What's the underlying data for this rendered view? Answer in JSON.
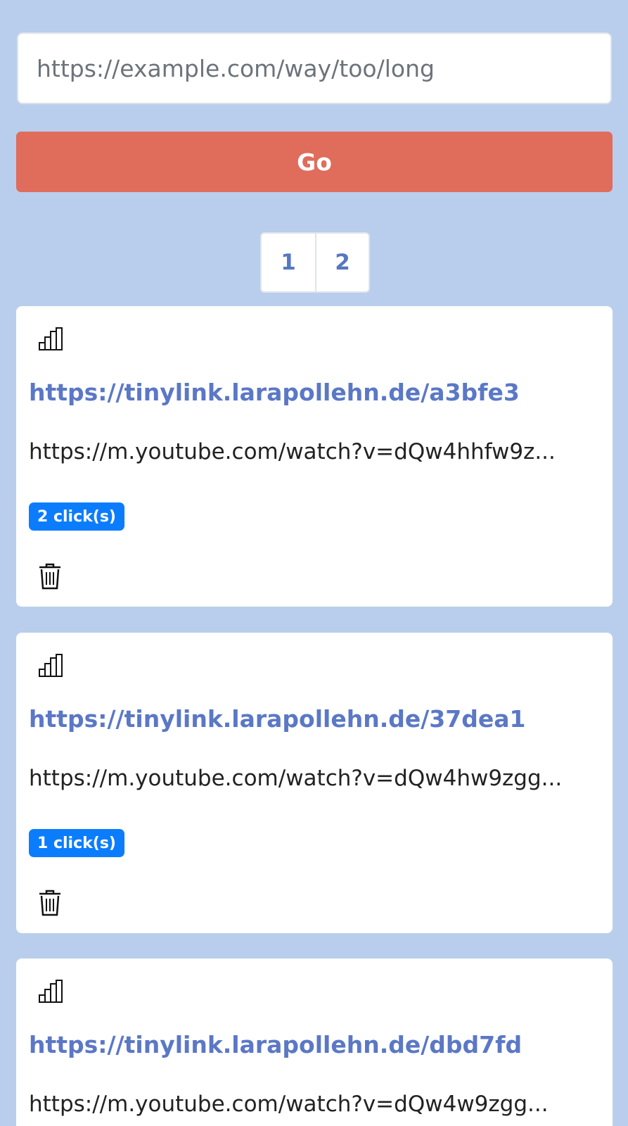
{
  "search": {
    "placeholder": "https://example.com/way/too/long",
    "value": ""
  },
  "go_button": {
    "label": "Go"
  },
  "pagination": {
    "pages": [
      "1",
      "2"
    ]
  },
  "links": [
    {
      "stats_icon": "bar-chart-icon",
      "short_url": "https://tinylink.larapollehn.de/a3bfe3",
      "long_url": "https://m.youtube.com/watch?v=dQw4hhfw9z...",
      "clicks": "2 click(s)",
      "delete_icon": "trash-icon"
    },
    {
      "stats_icon": "bar-chart-icon",
      "short_url": "https://tinylink.larapollehn.de/37dea1",
      "long_url": "https://m.youtube.com/watch?v=dQw4hw9zgg...",
      "clicks": "1 click(s)",
      "delete_icon": "trash-icon"
    },
    {
      "stats_icon": "bar-chart-icon",
      "short_url": "https://tinylink.larapollehn.de/dbd7fd",
      "long_url": "https://m.youtube.com/watch?v=dQw4w9zgg..."
    }
  ],
  "colors": {
    "background": "#b9ceec",
    "go_button": "#e06c5b",
    "link": "#5b78c6",
    "badge": "#0b7dfc"
  }
}
